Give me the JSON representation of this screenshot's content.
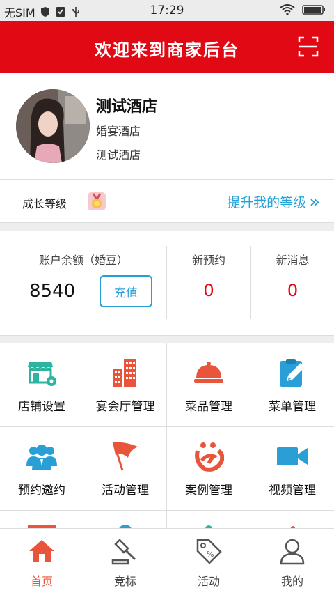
{
  "status_bar": {
    "carrier": "无SIM",
    "time": "17:29"
  },
  "header": {
    "title": "欢迎来到商家后台",
    "scan_icon": "scan-icon"
  },
  "profile": {
    "name": "测试酒店",
    "type": "婚宴酒店",
    "subtitle": "测试酒店"
  },
  "growth": {
    "label": "成长等级",
    "upgrade_label": "提升我的等级",
    "arrow": "»"
  },
  "stats": {
    "balance_label": "账户余额（婚豆）",
    "balance_value": "8540",
    "recharge_label": "充值",
    "new_booking_label": "新预约",
    "new_booking_value": "0",
    "new_message_label": "新消息",
    "new_message_value": "0"
  },
  "menu": [
    {
      "label": "店铺设置",
      "icon": "shop-settings-icon",
      "color": "#2bb5a0"
    },
    {
      "label": "宴会厅管理",
      "icon": "building-icon",
      "color": "#e8553a"
    },
    {
      "label": "菜品管理",
      "icon": "cloche-icon",
      "color": "#e8553a"
    },
    {
      "label": "菜单管理",
      "icon": "clipboard-edit-icon",
      "color": "#2a9fd6"
    },
    {
      "label": "预约邀约",
      "icon": "users-icon",
      "color": "#2a9fd6"
    },
    {
      "label": "活动管理",
      "icon": "flag-icon",
      "color": "#e8553a"
    },
    {
      "label": "案例管理",
      "icon": "case-icon",
      "color": "#e8553a"
    },
    {
      "label": "视频管理",
      "icon": "video-icon",
      "color": "#2a9fd6"
    }
  ],
  "tabbar": [
    {
      "label": "首页",
      "icon": "home-icon",
      "active": true
    },
    {
      "label": "竞标",
      "icon": "gavel-icon",
      "active": false
    },
    {
      "label": "活动",
      "icon": "tag-icon",
      "active": false
    },
    {
      "label": "我的",
      "icon": "user-icon",
      "active": false
    }
  ],
  "colors": {
    "brand_red": "#e10a14",
    "accent_blue": "#2a9fd6",
    "accent_orange": "#e8553a"
  }
}
